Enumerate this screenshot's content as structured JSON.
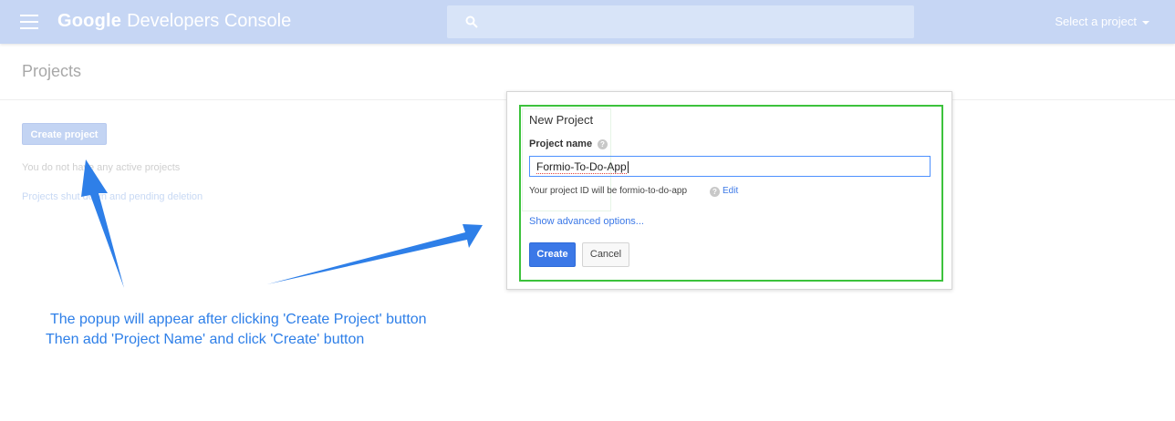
{
  "topbar": {
    "brand_google": "Google",
    "brand_product": "Developers Console",
    "project_select_label": "Select a project",
    "color": "#c6d6f4"
  },
  "page": {
    "title": "Projects",
    "create_button": "Create project",
    "empty_message": "You do not have any active projects",
    "pending_link": "Projects shut down and pending deletion"
  },
  "dialog": {
    "title": "New Project",
    "field_label": "Project name",
    "input_value": "Formio-To-Do-App",
    "project_id_text": "Your project ID will be formio-to-do-app",
    "edit_link": "Edit",
    "advanced_link": "Show advanced options...",
    "create_button": "Create",
    "cancel_button": "Cancel",
    "highlight_color": "#3cc23c"
  },
  "annotation": {
    "line1": "The popup will appear after clicking 'Create Project' button",
    "line2": "Then add 'Project Name' and click 'Create' button",
    "color": "#2e7fe8"
  },
  "icons": [
    "menu-icon",
    "search-icon",
    "chevron-down-icon",
    "help-icon",
    "arrow-icon"
  ]
}
